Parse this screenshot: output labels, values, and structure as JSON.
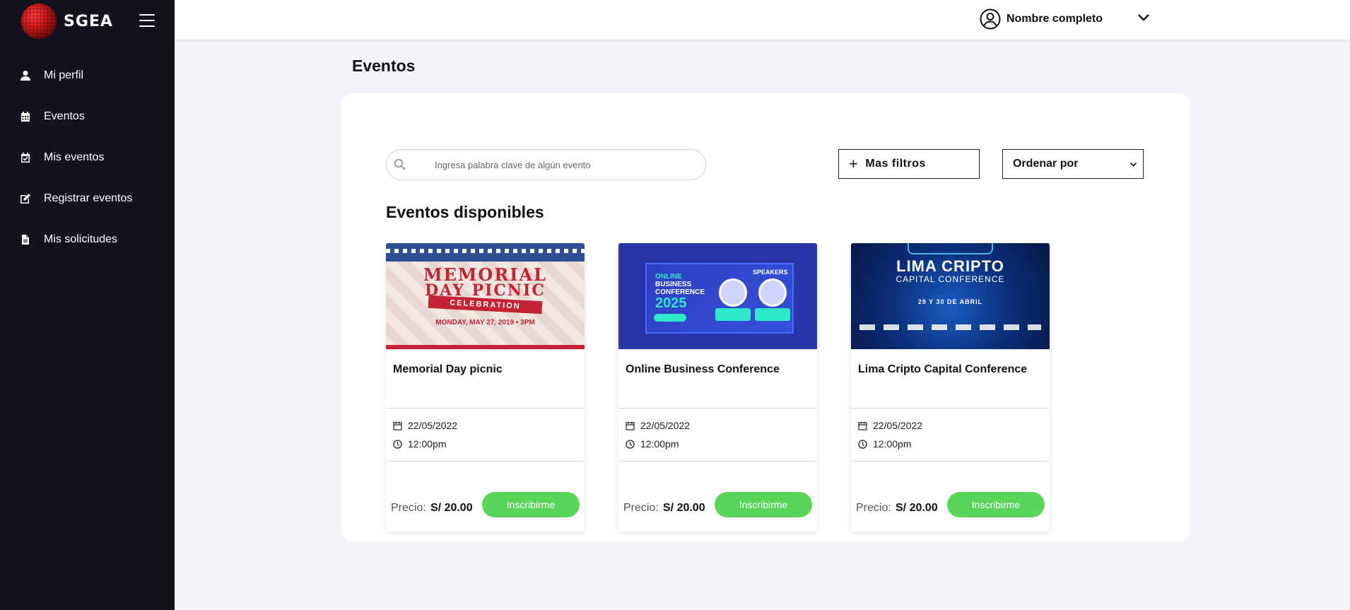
{
  "brand": {
    "name": "SGEA"
  },
  "sidebar": {
    "items": [
      {
        "label": "Mi perfil",
        "icon": "user-icon"
      },
      {
        "label": "Eventos",
        "icon": "calendar-icon"
      },
      {
        "label": "Mis eventos",
        "icon": "calendar-check-icon"
      },
      {
        "label": "Registrar eventos",
        "icon": "edit-icon"
      },
      {
        "label": "Mis solicitudes",
        "icon": "document-icon"
      }
    ]
  },
  "topbar": {
    "user_name": "Nombre completo"
  },
  "main": {
    "title": "Eventos",
    "search_placeholder": "Ingresa palabra clave de algún evento",
    "filters_label": "Mas filtros",
    "sort_label": "Ordenar por",
    "section_title": "Eventos disponibles"
  },
  "events": [
    {
      "title": "Memorial Day picnic",
      "date": "22/05/2022",
      "time": "12:00pm",
      "price_label": "Precio:",
      "price": "S/ 20.00",
      "action": "Inscribirme",
      "image_text": {
        "line1": "MEMORIAL",
        "line2": "DAY PICNIC",
        "ribbon": "CELEBRATION",
        "line3": "MONDAY, MAY 27, 2019 • 3PM"
      }
    },
    {
      "title": "Online Business Conference",
      "date": "22/05/2022",
      "time": "12:00pm",
      "price_label": "Precio:",
      "price": "S/ 20.00",
      "action": "Inscribirme",
      "image_text": {
        "line1": "ONLINE",
        "line2": "BUSINESS",
        "line3": "CONFERENCE",
        "year": "2025",
        "speakers": "SPEAKERS"
      }
    },
    {
      "title": "Lima Cripto Capital Conference",
      "date": "22/05/2022",
      "time": "12:00pm",
      "price_label": "Precio:",
      "price": "S/ 20.00",
      "action": "Inscribirme",
      "image_text": {
        "line1": "LIMA CRIPTO",
        "line2": "CAPITAL CONFERENCE",
        "line3": "29 Y 30 DE ABRIL"
      }
    }
  ],
  "colors": {
    "sidebar_bg": "#13131f",
    "accent_green": "#59d65a",
    "page_bg": "#f4f5fa"
  }
}
